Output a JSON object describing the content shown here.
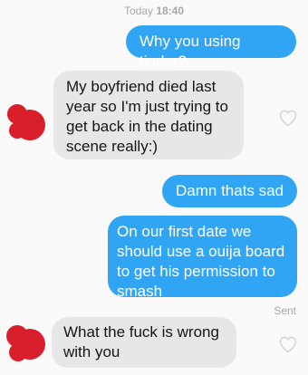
{
  "header": {
    "day": "Today",
    "time": "18:40"
  },
  "messages": [
    {
      "direction": "outgoing",
      "text": "Why you using tinder?"
    },
    {
      "direction": "incoming",
      "text": "My boyfriend died last year so I'm just trying to get back in the dating scene really:)"
    },
    {
      "direction": "outgoing",
      "text": "Damn thats sad"
    },
    {
      "direction": "outgoing",
      "text": "On our first date we should use a ouija board to get his permission to smash"
    },
    {
      "direction": "incoming",
      "text": "What the fuck is wrong with you"
    }
  ],
  "status": {
    "sent_label": "Sent"
  },
  "icons": {
    "like": "heart-outline-icon",
    "avatar": "redacted-avatar"
  },
  "colors": {
    "outgoing_bubble": "#30a5f3",
    "incoming_bubble": "#e7e7e7",
    "avatar_redaction": "#d81f2b"
  }
}
